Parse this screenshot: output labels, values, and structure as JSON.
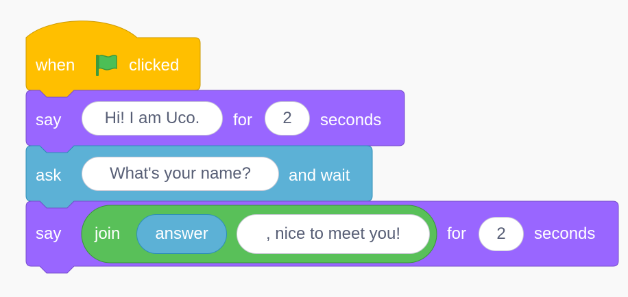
{
  "script": {
    "hat_block": {
      "label_before": "when",
      "flag_icon": "green-flag-icon",
      "label_after": "clicked",
      "color": "#FFBF00"
    },
    "say_block_1": {
      "label_say": "say",
      "message": "Hi! I am Uco.",
      "label_for": "for",
      "seconds": "2",
      "label_seconds": "seconds",
      "color": "#9966FF"
    },
    "ask_block": {
      "label_ask": "ask",
      "question": "What's your name?",
      "label_wait": "and wait",
      "color": "#5CB1D6"
    },
    "say_block_2": {
      "label_say": "say",
      "join_label": "join",
      "answer_label": "answer",
      "suffix_text": ", nice to meet you!",
      "label_for": "for",
      "seconds": "2",
      "label_seconds": "seconds",
      "color": "#9966FF",
      "join_color": "#59C059"
    }
  }
}
